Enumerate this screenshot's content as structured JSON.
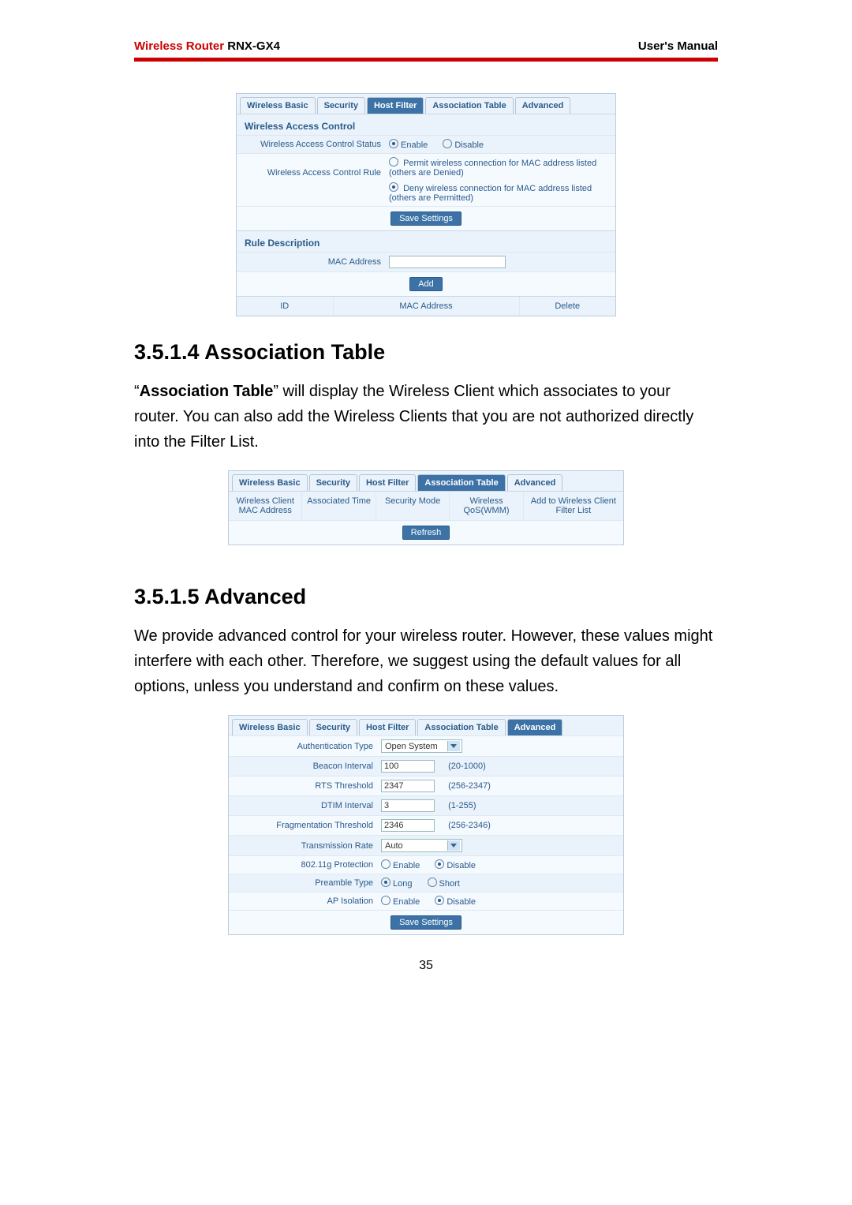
{
  "header": {
    "brand_red": "Wireless Router",
    "brand_model": " RNX-GX4",
    "right": "User's Manual"
  },
  "page_number": "35",
  "headings": {
    "assoc": "3.5.1.4 Association Table",
    "advanced": "3.5.1.5 Advanced"
  },
  "paragraphs": {
    "assoc": "“Association Table” will display the Wireless Client which associates to your router. You can also add the Wireless Clients that you are not authorized directly into the Filter List.",
    "advanced": "We provide advanced control for your wireless router. However, these values might interfere with each other. Therefore, we suggest using the default values for all options, unless you understand and confirm on these values.",
    "assoc_bold": "Association Table"
  },
  "tabs": {
    "basic": "Wireless Basic",
    "security": "Security",
    "hostfilter": "Host Filter",
    "assoc": "Association Table",
    "advanced": "Advanced"
  },
  "hostfilter": {
    "section1": "Wireless Access Control",
    "status_label": "Wireless Access Control Status",
    "enable": "Enable",
    "disable": "Disable",
    "rule_label": "Wireless Access Control Rule",
    "rule_permit": "Permit wireless connection for MAC address listed (others are Denied)",
    "rule_deny": "Deny wireless connection for MAC address listed (others are Permitted)",
    "save": "Save Settings",
    "section2": "Rule Description",
    "mac_label": "MAC Address",
    "mac_value": "",
    "add": "Add",
    "col_id": "ID",
    "col_mac": "MAC Address",
    "col_delete": "Delete"
  },
  "assoc_ui": {
    "col1": "Wireless Client MAC Address",
    "col2": "Associated Time",
    "col3": "Security Mode",
    "col4": "Wireless QoS(WMM)",
    "col5": "Add to Wireless Client Filter List",
    "refresh": "Refresh"
  },
  "advanced_ui": {
    "auth_label": "Authentication Type",
    "auth_value": "Open System",
    "beacon_label": "Beacon Interval",
    "beacon_value": "100",
    "beacon_range": "(20-1000)",
    "rts_label": "RTS Threshold",
    "rts_value": "2347",
    "rts_range": "(256-2347)",
    "dtim_label": "DTIM Interval",
    "dtim_value": "3",
    "dtim_range": "(1-255)",
    "frag_label": "Fragmentation Threshold",
    "frag_value": "2346",
    "frag_range": "(256-2346)",
    "tx_label": "Transmission Rate",
    "tx_value": "Auto",
    "g_label": "802.11g Protection",
    "preamble_label": "Preamble Type",
    "preamble_long": "Long",
    "preamble_short": "Short",
    "apiso_label": "AP Isolation",
    "enable": "Enable",
    "disable": "Disable",
    "save": "Save Settings"
  }
}
